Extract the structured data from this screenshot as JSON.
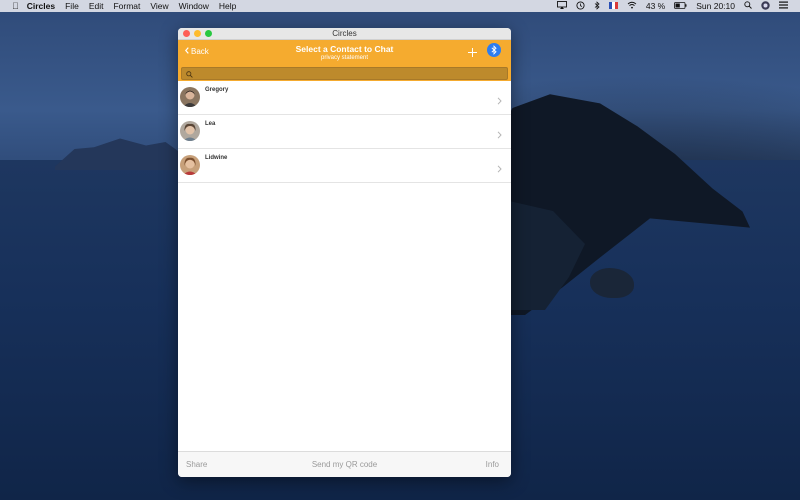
{
  "menubar": {
    "app_name": "Circles",
    "menus": [
      "File",
      "Edit",
      "Format",
      "View",
      "Window",
      "Help"
    ],
    "battery": "43 %",
    "clock": "Sun 20:10"
  },
  "window": {
    "title": "Circles",
    "nav": {
      "back_label": "Back",
      "title": "Select a Contact to Chat",
      "subtitle": "privacy statement"
    },
    "search": {
      "placeholder": ""
    },
    "contacts": [
      {
        "name": "Gregory"
      },
      {
        "name": "Lea"
      },
      {
        "name": "Lidwine"
      }
    ],
    "bottom": {
      "share_label": "Share",
      "qr_label": "Send my QR code",
      "info_label": "Info"
    }
  },
  "colors": {
    "accent": "#f5ab2f",
    "bluetooth": "#2d7df0"
  }
}
